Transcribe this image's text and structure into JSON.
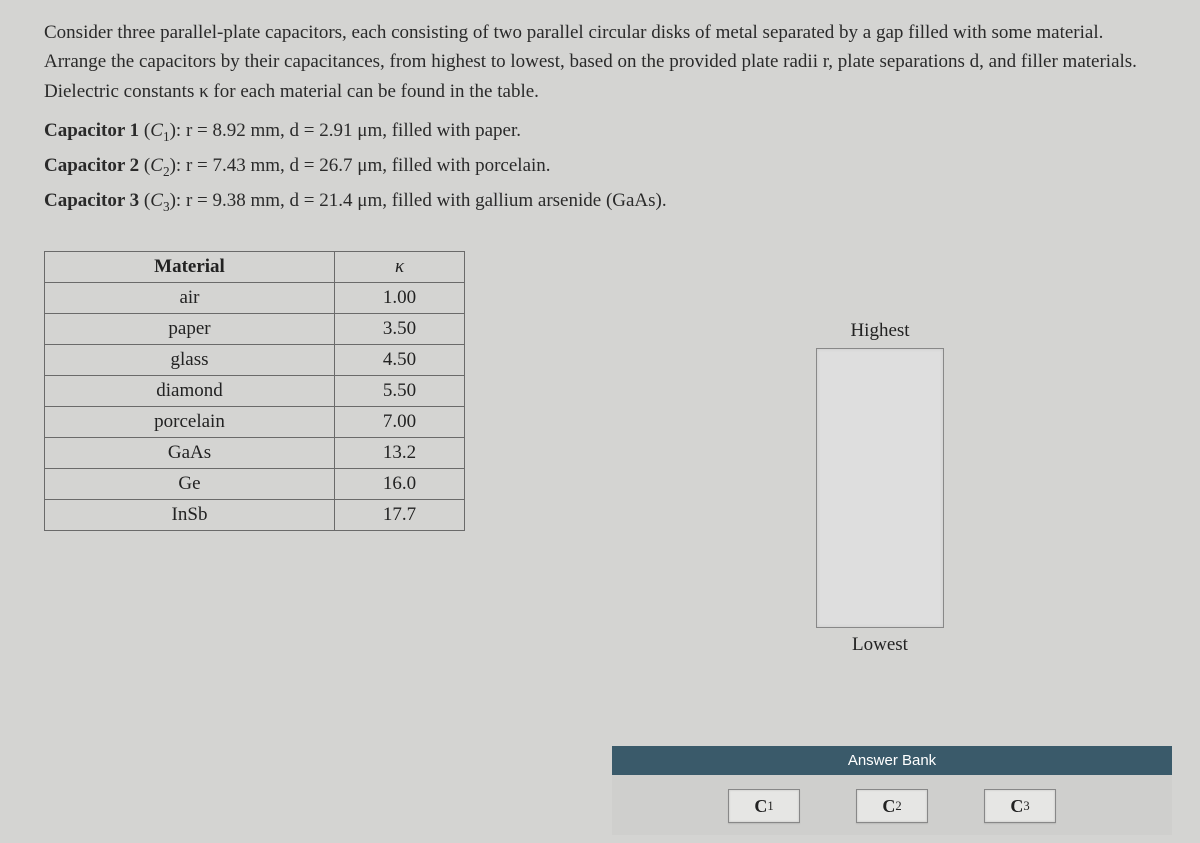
{
  "problem": {
    "intro": "Consider three parallel-plate capacitors, each consisting of two parallel circular disks of metal separated by a gap filled with some material. Arrange the capacitors by their capacitances, from highest to lowest, based on the provided plate radii r, plate separations d, and filler materials. Dielectric constants κ for each material can be found in the table.",
    "cap1_label": "Capacitor 1",
    "cap1_sym": "C",
    "cap1_sub": "1",
    "cap1_rest": "): r = 8.92 mm, d = 2.91 μm, filled with paper.",
    "cap2_label": "Capacitor 2",
    "cap2_sym": "C",
    "cap2_sub": "2",
    "cap2_rest": "): r = 7.43 mm, d = 26.7 μm, filled with porcelain.",
    "cap3_label": "Capacitor 3",
    "cap3_sym": "C",
    "cap3_sub": "3",
    "cap3_rest": "): r = 9.38 mm, d = 21.4 μm, filled with gallium arsenide (GaAs)."
  },
  "table": {
    "header_material": "Material",
    "header_kappa": "κ",
    "rows": [
      {
        "mat": "air",
        "k": "1.00"
      },
      {
        "mat": "paper",
        "k": "3.50"
      },
      {
        "mat": "glass",
        "k": "4.50"
      },
      {
        "mat": "diamond",
        "k": "5.50"
      },
      {
        "mat": "porcelain",
        "k": "7.00"
      },
      {
        "mat": "GaAs",
        "k": "13.2"
      },
      {
        "mat": "Ge",
        "k": "16.0"
      },
      {
        "mat": "InSb",
        "k": "17.7"
      }
    ]
  },
  "ranking": {
    "highest": "Highest",
    "lowest": "Lowest"
  },
  "answer_bank": {
    "title": "Answer Bank",
    "chips": [
      {
        "sym": "C",
        "sub": "1"
      },
      {
        "sym": "C",
        "sub": "2"
      },
      {
        "sym": "C",
        "sub": "3"
      }
    ]
  }
}
